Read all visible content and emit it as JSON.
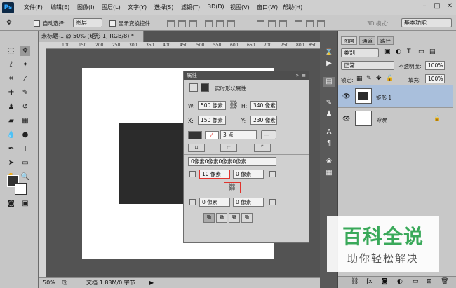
{
  "app": {
    "logo": "Ps"
  },
  "menu": [
    "文件(F)",
    "编辑(E)",
    "图像(I)",
    "图层(L)",
    "文字(Y)",
    "选择(S)",
    "滤镜(T)",
    "3D(D)",
    "视图(V)",
    "窗口(W)",
    "帮助(H)"
  ],
  "window_buttons": [
    "–",
    "□",
    "✕"
  ],
  "options": {
    "auto_select_label": "自动选择:",
    "auto_select_value": "图层",
    "show_transform_label": "显示变换控件",
    "mode_3d_label": "3D 模式:",
    "workspace": "基本功能"
  },
  "document": {
    "tab_title": "未标题-1 @ 50% (矩形 1, RGB/8) *",
    "zoom": "50%",
    "doc_info": "文档:1.83M/0 字节",
    "ruler_ticks": [
      "100",
      "150",
      "200",
      "250",
      "300",
      "350",
      "400",
      "450",
      "500",
      "550",
      "600",
      "650",
      "700",
      "750",
      "800",
      "850"
    ]
  },
  "properties": {
    "panel_title": "属性",
    "section_title": "实时形状属性",
    "w_label": "W:",
    "w_value": "500 像素",
    "h_label": "H:",
    "h_value": "340 像素",
    "x_label": "X:",
    "x_value": "150 像素",
    "y_label": "Y:",
    "y_value": "230 像素",
    "stroke_size": "3 点",
    "corners_all": "0像素0像素0像素0像素",
    "corner_tl": "10 像素",
    "corner_tr": "0 像素",
    "corner_bl": "0 像素",
    "corner_br": "0 像素"
  },
  "layers": {
    "tabs": [
      "图层",
      "通道",
      "路径"
    ],
    "filter_kind": "类别",
    "blend_mode": "正常",
    "opacity_label": "不透明度:",
    "opacity_value": "100%",
    "lock_label": "锁定:",
    "fill_label": "填充:",
    "fill_value": "100%",
    "items": [
      {
        "name": "矩形 1",
        "selected": true
      },
      {
        "name": "背景",
        "selected": false
      }
    ]
  },
  "watermark": {
    "title": "百科全说",
    "subtitle": "助你轻松解决"
  },
  "colors": {
    "accent_red": "#e0332d",
    "selected_layer": "#a9bfdc",
    "watermark_green": "#3aa95a"
  }
}
